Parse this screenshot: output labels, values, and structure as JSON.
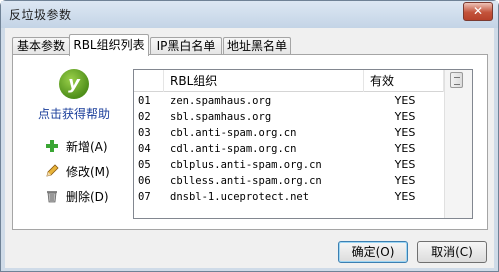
{
  "window": {
    "title": "反垃圾参数",
    "close_label": "✕"
  },
  "tabs": [
    {
      "label": "基本参数",
      "active": false
    },
    {
      "label": "RBL组织列表",
      "active": true
    },
    {
      "label": "IP黑白名单",
      "active": false
    },
    {
      "label": "地址黑名单",
      "active": false
    }
  ],
  "help": {
    "logo_text": "y",
    "label": "点击获得帮助"
  },
  "actions": [
    {
      "label": "新增(A)",
      "icon": "plus-icon"
    },
    {
      "label": "修改(M)",
      "icon": "pencil-icon"
    },
    {
      "label": "删除(D)",
      "icon": "trash-icon"
    }
  ],
  "list": {
    "columns": [
      "",
      "RBL组织",
      "有效"
    ],
    "rows": [
      {
        "no": "01",
        "name": "zen.spamhaus.org",
        "valid": "YES"
      },
      {
        "no": "02",
        "name": "sbl.spamhaus.org",
        "valid": "YES"
      },
      {
        "no": "03",
        "name": "cbl.anti-spam.org.cn",
        "valid": "YES"
      },
      {
        "no": "04",
        "name": "cdl.anti-spam.org.cn",
        "valid": "YES"
      },
      {
        "no": "05",
        "name": "cblplus.anti-spam.org.cn",
        "valid": "YES"
      },
      {
        "no": "06",
        "name": "cblless.anti-spam.org.cn",
        "valid": "YES"
      },
      {
        "no": "07",
        "name": "dnsbl-1.uceprotect.net",
        "valid": "YES"
      }
    ]
  },
  "buttons": {
    "ok_label": "确定(O)",
    "cancel_label": "取消(C)"
  },
  "colors": {
    "accent": "#1b3f9b",
    "window_frame": "#cfdbe8",
    "plus": "#3aa634"
  }
}
